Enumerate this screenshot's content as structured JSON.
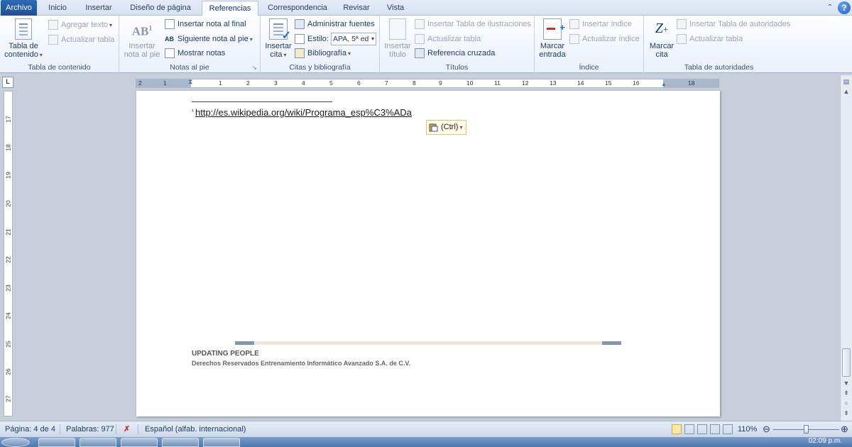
{
  "tabs": {
    "file": "Archivo",
    "items": [
      "Inicio",
      "Insertar",
      "Diseño de página",
      "Referencias",
      "Correspondencia",
      "Revisar",
      "Vista"
    ],
    "active": "Referencias"
  },
  "ribbon": {
    "toc": {
      "big_label_1": "Tabla de",
      "big_label_2": "contenido",
      "add_text": "Agregar texto",
      "update_table": "Actualizar tabla",
      "group_label": "Tabla de contenido"
    },
    "footnotes": {
      "insert_footnote_1": "Insertar",
      "insert_footnote_2": "nota al pie",
      "insert_endnote": "Insertar nota al final",
      "next_footnote": "Siguiente nota al pie",
      "show_notes": "Mostrar notas",
      "group_label": "Notas al pie"
    },
    "citations": {
      "insert_citation_1": "Insertar",
      "insert_citation_2": "cita",
      "manage_sources": "Administrar fuentes",
      "style_label": "Estilo:",
      "style_value": "APA, 5ª ed",
      "bibliography": "Bibliografía",
      "group_label": "Citas y bibliografía"
    },
    "captions": {
      "insert_caption_1": "Insertar",
      "insert_caption_2": "título",
      "insert_table_figures": "Insertar Tabla de ilustraciones",
      "update_table": "Actualizar tabla",
      "cross_reference": "Referencia cruzada",
      "group_label": "Títulos"
    },
    "index": {
      "mark_entry_1": "Marcar",
      "mark_entry_2": "entrada",
      "insert_index": "Insertar índice",
      "update_index": "Actualizar índice",
      "group_label": "Índice"
    },
    "authorities": {
      "mark_citation_1": "Marcar",
      "mark_citation_2": "cita",
      "insert_table": "Insertar Tabla de autoridades",
      "update_table": "Actualizar tabla",
      "group_label": "Tabla de autoridades"
    }
  },
  "ruler": {
    "tab_selector": "L",
    "h_numbers": [
      "2",
      "1",
      "1",
      "2",
      "3",
      "4",
      "5",
      "6",
      "7",
      "8",
      "9",
      "10",
      "11",
      "12",
      "13",
      "14",
      "15",
      "16",
      "18"
    ],
    "v_numbers": [
      "17",
      "18",
      "19",
      "20",
      "21",
      "22",
      "23",
      "24",
      "25",
      "26",
      "27"
    ]
  },
  "document": {
    "footnote_marker": "¹",
    "footnote_link": "http://es.wikipedia.org/wiki/Programa_esp%C3%ADa",
    "paste_options": "(Ctrl)",
    "footer_title": "UPDATING PEOPLE",
    "footer_subtitle": "Derechos Reservados Entrenamiento Informático Avanzado S.A. de C.V."
  },
  "statusbar": {
    "page": "Página: 4 de 4",
    "words": "Palabras: 977",
    "language": "Español (alfab. internacional)",
    "zoom": "110%"
  },
  "taskbar": {
    "clock": "02:09 p.m."
  },
  "colors": {
    "file_tab": "#2f6bb8",
    "ribbon_bg": "#eaf1fa",
    "status_bg": "#ccd8e9",
    "taskbar": "#4f78ad"
  }
}
